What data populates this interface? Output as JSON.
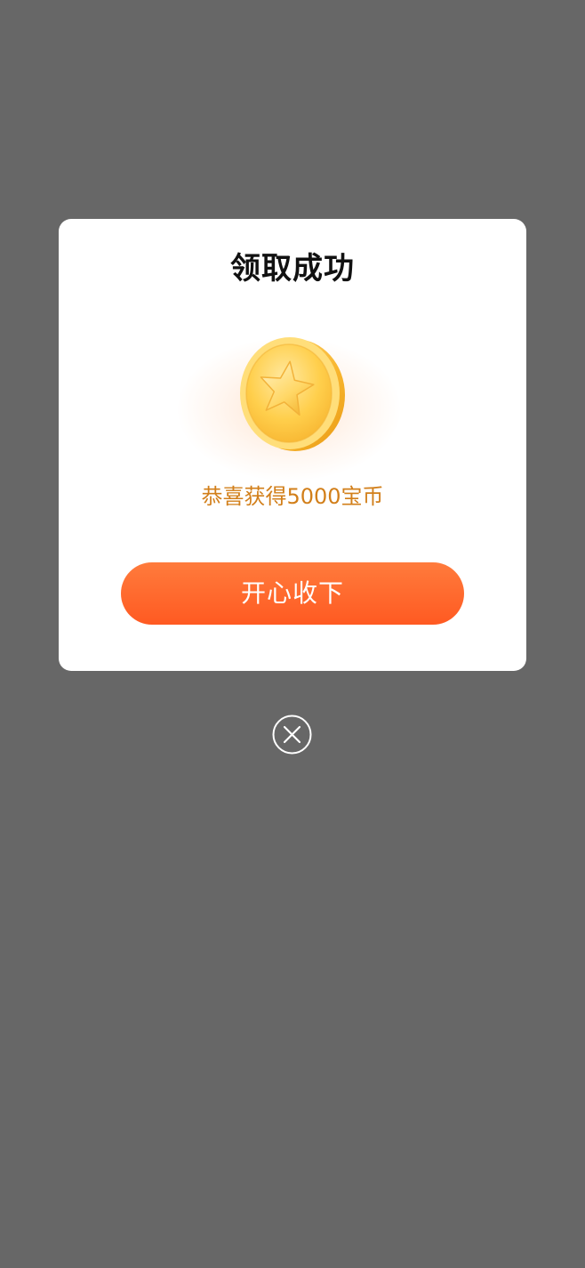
{
  "dialog": {
    "title": "领取成功",
    "reward_text": "恭喜获得5000宝币",
    "accept_label": "开心收下",
    "coin_icon": "star-coin-icon",
    "close_icon": "close-circle-icon"
  },
  "colors": {
    "overlay": "#676767",
    "dialog_bg": "#ffffff",
    "reward_text": "#d27f1a",
    "button_top": "#ff7b3c",
    "button_bottom": "#ff5a22",
    "coin_gold": "#ffc43a"
  }
}
